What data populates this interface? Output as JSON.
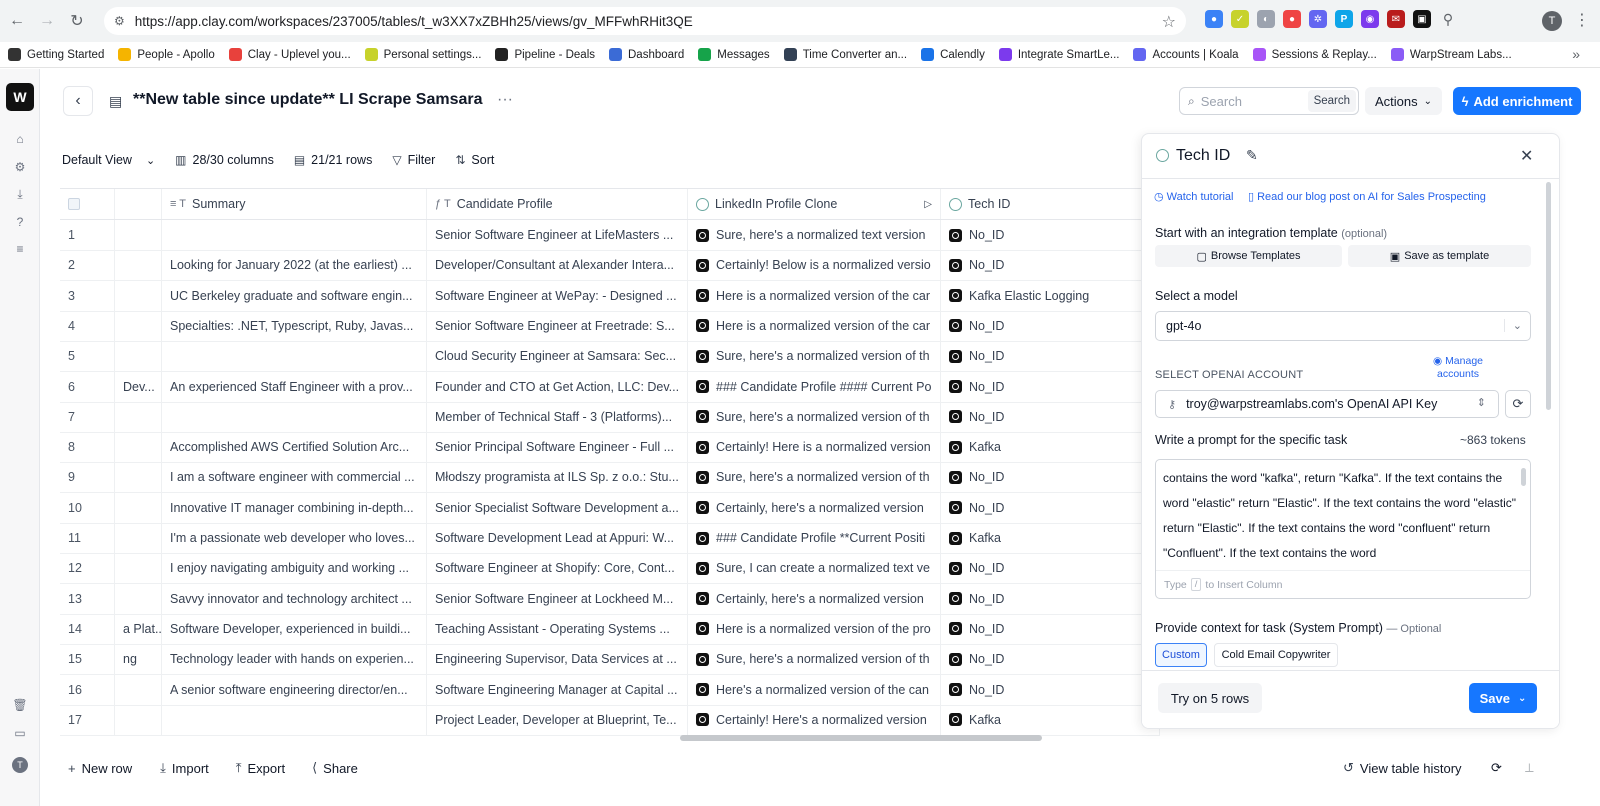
{
  "browser": {
    "url": "https://app.clay.com/workspaces/237005/tables/t_w3XX7xZBHh25/views/gv_MFFwhRHit3QE",
    "profile_initial": "T",
    "bookmarks": [
      {
        "label": "Getting Started",
        "color": "#333333"
      },
      {
        "label": "People - Apollo",
        "color": "#f5b400"
      },
      {
        "label": "Clay - Uplevel you...",
        "color": "#e8413c"
      },
      {
        "label": "Personal settings...",
        "color": "#c7d22b"
      },
      {
        "label": "Pipeline - Deals",
        "color": "#222222"
      },
      {
        "label": "Dashboard",
        "color": "#3b6bd6"
      },
      {
        "label": "Messages",
        "color": "#16a34a"
      },
      {
        "label": "Time Converter an...",
        "color": "#334155"
      },
      {
        "label": "Calendly",
        "color": "#1a73e8"
      },
      {
        "label": "Integrate SmartLe...",
        "color": "#7c3aed"
      },
      {
        "label": "Accounts | Koala",
        "color": "#6366f1"
      },
      {
        "label": "Sessions & Replay...",
        "color": "#a855f7"
      },
      {
        "label": "WarpStream Labs...",
        "color": "#8b5cf6"
      }
    ]
  },
  "header": {
    "title": "**New table since update** LI Scrape Samsara",
    "search_placeholder": "Search",
    "search_button": "Search",
    "actions_label": "Actions",
    "enrich_label": "Add enrichment"
  },
  "toolbar": {
    "view": "Default View",
    "columns": "28/30 columns",
    "rows": "21/21 rows",
    "filter": "Filter",
    "sort": "Sort"
  },
  "table": {
    "headers": [
      "Summary",
      "Candidate Profile",
      "LinkedIn Profile Clone",
      "Tech ID"
    ],
    "rows": [
      {
        "n": "1",
        "a": "",
        "summary": "",
        "profile": "Senior Software Engineer at LifeMasters ...",
        "clone": "Sure, here's a normalized text version",
        "tech": "No_ID"
      },
      {
        "n": "2",
        "a": "",
        "summary": "Looking for January 2022 (at the earliest) ...",
        "profile": "Developer/Consultant at Alexander Intera...",
        "clone": "Certainly! Below is a normalized versio",
        "tech": "No_ID"
      },
      {
        "n": "3",
        "a": "",
        "summary": "UC Berkeley graduate and software engin...",
        "profile": "Software Engineer at WePay: - Designed ...",
        "clone": "Here is a normalized version of the car",
        "tech": "Kafka Elastic Logging"
      },
      {
        "n": "4",
        "a": "",
        "summary": "Specialties: .NET, Typescript, Ruby, Javas...",
        "profile": "Senior Software Engineer at Freetrade: S...",
        "clone": "Here is a normalized version of the car",
        "tech": "No_ID"
      },
      {
        "n": "5",
        "a": "",
        "summary": "",
        "profile": "Cloud Security Engineer at Samsara: Sec...",
        "clone": "Sure, here's a normalized version of th",
        "tech": "No_ID"
      },
      {
        "n": "6",
        "a": "Dev...",
        "summary": "An experienced Staff Engineer with a prov...",
        "profile": "Founder and CTO at Get Action, LLC: Dev...",
        "clone": "### Candidate Profile #### Current Po",
        "tech": "No_ID"
      },
      {
        "n": "7",
        "a": "",
        "summary": "",
        "profile": "Member of Technical Staff - 3 (Platforms)...",
        "clone": "Sure, here's a normalized version of th",
        "tech": "No_ID"
      },
      {
        "n": "8",
        "a": "",
        "summary": "Accomplished AWS Certified Solution Arc...",
        "profile": "Senior Principal Software Engineer - Full ...",
        "clone": "Certainly! Here is a normalized version",
        "tech": "Kafka"
      },
      {
        "n": "9",
        "a": "",
        "summary": "I am a software engineer with commercial ...",
        "profile": "Młodszy programista at ILS Sp. z o.o.: Stu...",
        "clone": "Sure, here's a normalized version of th",
        "tech": "No_ID"
      },
      {
        "n": "10",
        "a": "",
        "summary": "Innovative IT manager combining in-depth...",
        "profile": "Senior Specialist Software Development a...",
        "clone": "Certainly, here's a normalized version",
        "tech": "No_ID"
      },
      {
        "n": "11",
        "a": "",
        "summary": "I'm a passionate web developer who loves...",
        "profile": "Software Development Lead at Appuri: W...",
        "clone": "### Candidate Profile **Current Positi",
        "tech": "Kafka"
      },
      {
        "n": "12",
        "a": "",
        "summary": "I enjoy navigating ambiguity and working ...",
        "profile": "Software Engineer at Shopify: Core, Cont...",
        "clone": "Sure, I can create a normalized text ve",
        "tech": "No_ID"
      },
      {
        "n": "13",
        "a": "",
        "summary": "Savvy innovator and technology architect ...",
        "profile": "Senior Software Engineer at Lockheed M...",
        "clone": "Certainly, here's a normalized version",
        "tech": "No_ID"
      },
      {
        "n": "14",
        "a": "a Plat...",
        "summary": "Software Developer, experienced in buildi...",
        "profile": "Teaching Assistant - Operating Systems ...",
        "clone": "Here is a normalized version of the pro",
        "tech": "No_ID"
      },
      {
        "n": "15",
        "a": "ng",
        "summary": "Technology leader with hands on experien...",
        "profile": "Engineering Supervisor, Data Services at ...",
        "clone": "Sure, here's a normalized version of th",
        "tech": "No_ID"
      },
      {
        "n": "16",
        "a": "",
        "summary": "A senior software engineering director/en...",
        "profile": "Software Engineering Manager at Capital ...",
        "clone": "Here's a normalized version of the can",
        "tech": "No_ID"
      },
      {
        "n": "17",
        "a": "",
        "summary": "",
        "profile": "Project Leader, Developer at Blueprint, Te...",
        "clone": "Certainly! Here's a normalized version",
        "tech": "Kafka"
      }
    ]
  },
  "bottom": {
    "new_row": "New row",
    "import": "Import",
    "export": "Export",
    "share": "Share",
    "history": "View table history"
  },
  "panel": {
    "title": "Tech ID",
    "watch_tutorial": "Watch tutorial",
    "blog_post": "Read our blog post on AI for Sales Prospecting",
    "template_label": "Start with an integration template",
    "template_optional": "(optional)",
    "browse_templates": "Browse Templates",
    "save_template": "Save as template",
    "model_label": "Select a model",
    "model_value": "gpt-4o",
    "account_label": "SELECT OPENAI ACCOUNT",
    "manage_accounts": "Manage accounts",
    "account_value": "troy@warpstreamlabs.com's OpenAI API Key",
    "prompt_label": "Write a prompt for the specific task",
    "tokens": "~863 tokens",
    "prompt_text": "contains the word \"kafka\", return \"Kafka\". If the text contains the word \"elastic\" return \"Elastic\". If the text contains the word \"elastic\" return \"Elastic\". If the text contains the word \"confluent\" return \"Confluent\".  If the text contains the word",
    "prompt_hint_type": "Type",
    "prompt_hint_key": "/",
    "prompt_hint_rest": "to Insert Column",
    "context_label": "Provide context for task (System Prompt)",
    "context_optional": "— Optional",
    "chip_custom": "Custom",
    "chip_cold": "Cold Email Copywriter",
    "try_label": "Try on 5 rows",
    "save_label": "Save"
  }
}
